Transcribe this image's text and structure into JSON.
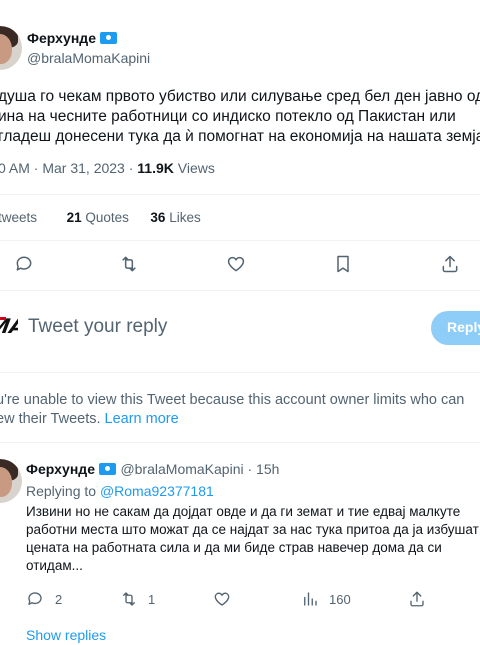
{
  "tweet": {
    "author_name": "Ферхунде",
    "author_handle": "@bralaMomaKapini",
    "text_lines": [
      "душа го чекам првото убиство или силување сред бел ден јавно од",
      "ина на чесните работници со индиско потекло од Пакистан или",
      "гладеш донесени тука да ѝ помогнат на економија на нашата земја"
    ],
    "time": "0 AM · Mar 31, 2023 · ",
    "views_count": "11.9K",
    "views_label": " Views",
    "retweets_label": "tweets",
    "quotes_count": "21",
    "quotes_label": " Quotes",
    "likes_count": "36",
    "likes_label": " Likes"
  },
  "actions": {
    "icons": [
      "reply-icon",
      "retweet-icon",
      "like-icon",
      "bookmark-icon",
      "share-icon"
    ]
  },
  "composer": {
    "avatar_text": "MA",
    "placeholder": "Tweet your reply",
    "reply_button": "Reply"
  },
  "notice": {
    "line1": "u're unable to view this Tweet because this account owner limits who can",
    "line2_prefix": "ew their Tweets. ",
    "learn_more": "Learn more"
  },
  "reply": {
    "author_name": "Ферхунде",
    "author_handle": "@bralaMomaKapini",
    "age": " · 15h",
    "replying_to_prefix": "Replying to ",
    "replying_to_handle": "@Roma92377181",
    "text_lines": [
      "Извини но не сакам да дојдат овде и да ги земат  и тие едвај малкуте",
      "работни места што можат да се најдат за нас тука притоа да ја избушат",
      "цената на работната сила и да ми биде страв навечер дома да си",
      "отидам..."
    ],
    "reply_count": "2",
    "retweet_count": "1",
    "views_count": "160"
  },
  "show_replies": "Show replies",
  "colors": {
    "accent": "#1d9bf0",
    "reply_button_bg": "#8ecdf8",
    "secondary_text": "#536471",
    "divider": "#eff3f4"
  }
}
